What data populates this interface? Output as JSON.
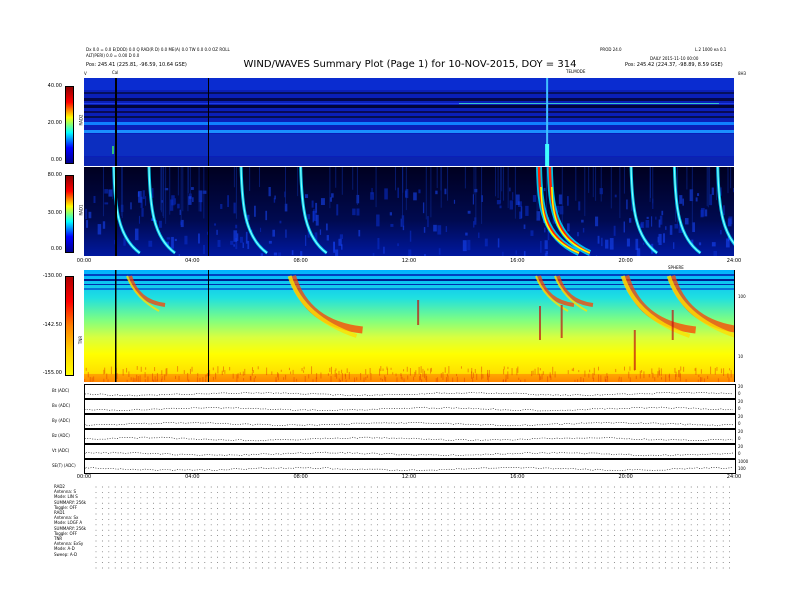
{
  "header": {
    "left_line1": "Dx 0.0 = 0.0 E(DOD) 0.0 Q RAD(R D) 0.0 ME(A) 0.0 TW 0.0 0.0 OZ ROLL",
    "left_line2": "ALT(PERI) 0.0 = 0.00 D 0.0",
    "left_line3": "Pos: 245.41 (225.81, -96.59, 10.64 GSE)",
    "title": "WIND/WAVES Summary Plot (Page 1) for 10-NOV-2015, DOY = 314",
    "right_top1": "PROD 24.0",
    "right_top2": "L.2 1000 ea 0.1",
    "right_mid": "DAILY 2015-11-10 00:00",
    "right_line3": "Pos: 245.42 (224.37, -98.89, 8.59 GSE)",
    "start_marker": "V",
    "cal_marker": "Cal",
    "telmode": "TELMODE",
    "end_marker": "8H3"
  },
  "panels": {
    "rad2": {
      "label": "RAD2",
      "ticks": [
        "40.00",
        "20.00",
        "0.00"
      ]
    },
    "rad1": {
      "label": "RAD1",
      "ticks": [
        "80.00",
        "30.00",
        "0.00"
      ]
    },
    "tnr": {
      "label": "TNR",
      "ticks": [
        "-130.00",
        "-142.50",
        "-155.00"
      ],
      "right_ticks": [
        "100",
        "10"
      ],
      "right_header": "SPHERE"
    }
  },
  "time_axis": [
    "00:00",
    "04:00",
    "08:00",
    "12:00",
    "16:00",
    "20:00",
    "24:00"
  ],
  "line_panels": [
    {
      "label": "Bt (ADC)",
      "right": [
        "20",
        "0"
      ]
    },
    {
      "label": "Bx (ADC)",
      "right": [
        "20",
        "0"
      ]
    },
    {
      "label": "By (ADC)",
      "right": [
        "20",
        "0"
      ]
    },
    {
      "label": "Bz (ADC)",
      "right": [
        "20",
        "0"
      ]
    },
    {
      "label": "Vt (ADC)",
      "right": [
        "20",
        "0"
      ]
    },
    {
      "label": "SE(T) (ADC)",
      "right": [
        "1000",
        "100"
      ]
    }
  ],
  "settings": {
    "rad2": [
      "RAD2",
      "Antenna: S",
      "Mode: LIN S",
      "SUMMARY: 256k",
      "Toggle: OFF"
    ],
    "rad1": [
      "RAD1",
      "Antenna: Sx",
      "Mode: LOGF A",
      "SUMMARY: 256k",
      "Toggle: OFF"
    ],
    "tnr": [
      "TNR",
      "Antenna: ExSy",
      "Mode: A-D",
      "Sweep: A-D"
    ]
  },
  "colors": {
    "spectrum_low": "#0000a0",
    "spectrum_high": "#c00000",
    "tnr_background": "#ffee00"
  },
  "chart_data": {
    "type": "heatmap",
    "title": "WIND/WAVES Summary Plot (Page 1) for 10-NOV-2015, DOY = 314",
    "x_unit": "UT hours",
    "xlim": [
      0,
      24
    ],
    "series": [
      {
        "name": "RAD2",
        "ylim": [
          0,
          40
        ],
        "burst_times": [
          17.1
        ]
      },
      {
        "name": "RAD1",
        "ylim": [
          0,
          80
        ],
        "burst_times": [
          1.1,
          2.4,
          5.8,
          8.0,
          16.8,
          17.2,
          20.2,
          21.8,
          23.4
        ]
      },
      {
        "name": "TNR",
        "ylim": [
          -155,
          -130
        ],
        "burst_times": [
          1.7,
          7.7,
          16.8,
          17.5,
          20.0,
          21.7
        ]
      }
    ],
    "data_gaps": [
      1.2,
      4.6
    ]
  }
}
